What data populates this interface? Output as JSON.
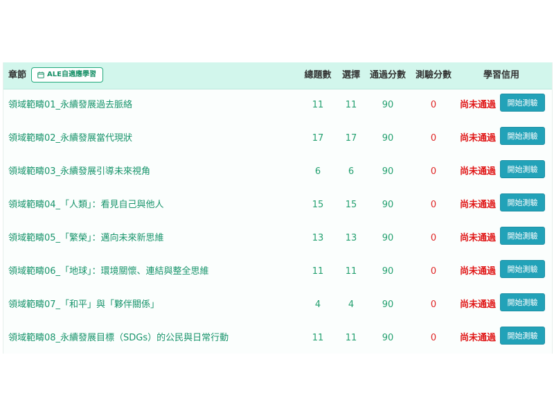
{
  "header": {
    "chapter_label": "章節",
    "ale_button_label": "ALE自適應學習",
    "columns": {
      "total": "總題數",
      "select": "選擇",
      "pass_score": "通過分數",
      "test_score": "測驗分數",
      "credit": "學習信用"
    }
  },
  "rows": [
    {
      "title": "領域範疇01_永續發展過去脈絡",
      "total": "11",
      "select": "11",
      "pass_score": "90",
      "test_score": "0",
      "status": "尚未通過",
      "action": "開始測驗"
    },
    {
      "title": "領域範疇02_永續發展當代現狀",
      "total": "17",
      "select": "17",
      "pass_score": "90",
      "test_score": "0",
      "status": "尚未通過",
      "action": "開始測驗"
    },
    {
      "title": "領域範疇03_永續發展引導未來視角",
      "total": "6",
      "select": "6",
      "pass_score": "90",
      "test_score": "0",
      "status": "尚未通過",
      "action": "開始測驗"
    },
    {
      "title": "領域範疇04_「人類」：看見自己與他人",
      "total": "15",
      "select": "15",
      "pass_score": "90",
      "test_score": "0",
      "status": "尚未通過",
      "action": "開始測驗"
    },
    {
      "title": "領域範疇05_「繁榮」：邁向未來新思維",
      "total": "13",
      "select": "13",
      "pass_score": "90",
      "test_score": "0",
      "status": "尚未通過",
      "action": "開始測驗"
    },
    {
      "title": "領域範疇06_「地球」：環境關懷、連結與整全思維",
      "total": "11",
      "select": "11",
      "pass_score": "90",
      "test_score": "0",
      "status": "尚未通過",
      "action": "開始測驗"
    },
    {
      "title": "領域範疇07_「和平」與「夥伴關係」",
      "total": "4",
      "select": "4",
      "pass_score": "90",
      "test_score": "0",
      "status": "尚未通過",
      "action": "開始測驗"
    },
    {
      "title": "領域範疇08_永續發展目標（SDGs）的公民與日常行動",
      "total": "11",
      "select": "11",
      "pass_score": "90",
      "test_score": "0",
      "status": "尚未通過",
      "action": "開始測驗"
    }
  ],
  "colors": {
    "header_bg": "#d2f6ec",
    "link_green": "#17946b",
    "fail_red": "#e01515",
    "button_teal": "#22a2b8"
  }
}
